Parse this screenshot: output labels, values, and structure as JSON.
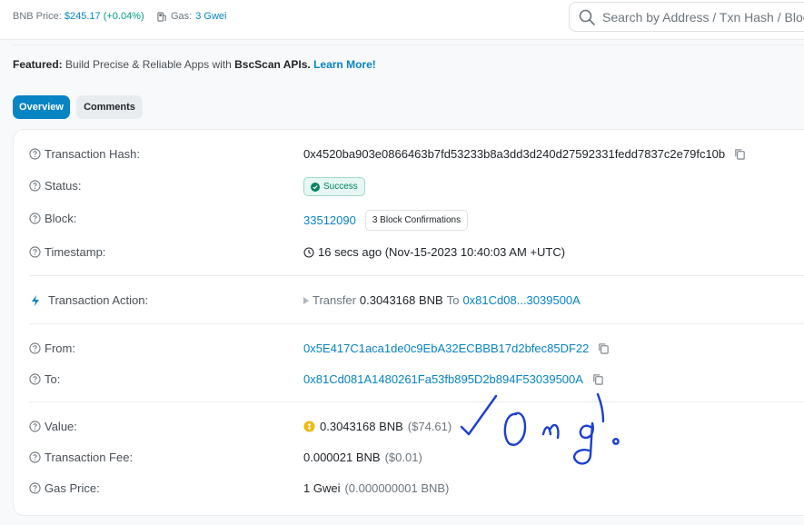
{
  "header": {
    "bnb_price_label": "BNB Price:",
    "bnb_price_value": "$245.17",
    "bnb_price_change": "(+0.04%)",
    "gas_label": "Gas:",
    "gas_value": "3 Gwei",
    "search_placeholder": "Search by Address / Txn Hash / Block"
  },
  "featured": {
    "label": "Featured:",
    "text_before": " Build Precise & Reliable Apps with ",
    "brand": "BscScan APIs.",
    "link": "Learn More!"
  },
  "tabs": [
    {
      "label": "Overview",
      "active": true
    },
    {
      "label": "Comments",
      "active": false
    }
  ],
  "tx": {
    "hash_label": "Transaction Hash:",
    "hash_value": "0x4520ba903e0866463b7fd53233b8a3dd3d240d27592331fedd7837c2e79fc10b",
    "status_label": "Status:",
    "status_value": "Success",
    "block_label": "Block:",
    "block_value": "33512090",
    "block_confirmations": "3 Block Confirmations",
    "timestamp_label": "Timestamp:",
    "timestamp_value": "16 secs ago (Nov-15-2023 10:40:03 AM +UTC)",
    "action_label": "Transaction Action:",
    "action_verb": "Transfer",
    "action_amount": "0.3043168 BNB",
    "action_to_word": "To",
    "action_to_addr": "0x81Cd08...3039500A",
    "from_label": "From:",
    "from_value": "0x5E417C1aca1de0c9EbA32ECBBB17d2bfec85DF22",
    "to_label": "To:",
    "to_value": "0x81Cd081A1480261Fa53fb895D2b894F53039500A",
    "value_label": "Value:",
    "value_amount": "0.3043168 BNB",
    "value_usd": "($74.61)",
    "fee_label": "Transaction Fee:",
    "fee_amount": "0.000021 BNB",
    "fee_usd": "($0.01)",
    "gas_price_label": "Gas Price:",
    "gas_price_value": "1 Gwei",
    "gas_price_bnb": "(0.000000001 BNB)"
  },
  "colors": {
    "link": "#0784c3",
    "success": "#00845f",
    "handwriting": "#1a3fd1"
  }
}
